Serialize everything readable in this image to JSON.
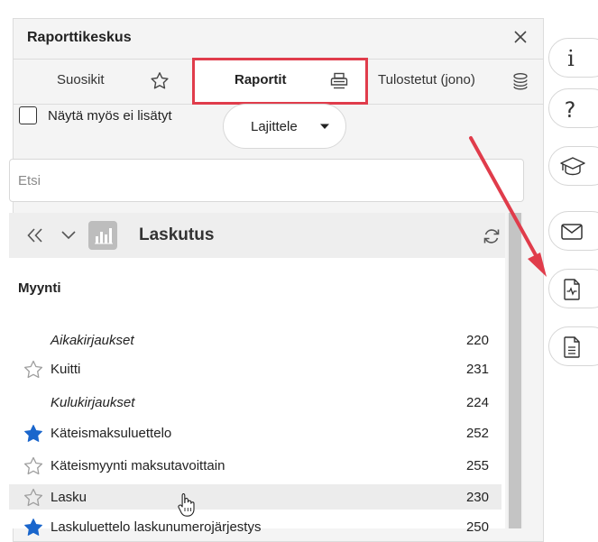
{
  "panel": {
    "title": "Raporttikeskus",
    "close_icon": "close-icon"
  },
  "tabs": [
    {
      "label": "Suosikit",
      "icon": "star-outline-icon"
    },
    {
      "label": "Raportit",
      "icon": "printer-icon",
      "active": true
    },
    {
      "label": "Tulostetut (jono)",
      "icon": "stack-icon"
    }
  ],
  "filters": {
    "show_not_added_label": "Näytä myös ei lisätyt",
    "sort_label": "Lajittele"
  },
  "search": {
    "placeholder": "Etsi",
    "value": ""
  },
  "group": {
    "title": "Laskutus"
  },
  "section": {
    "title": "Myynti"
  },
  "reports": [
    {
      "label": "Aikakirjaukset",
      "number": "220",
      "italic": true,
      "star": "none"
    },
    {
      "label": "Kuitti",
      "number": "231",
      "italic": false,
      "star": "outline"
    },
    {
      "label": "Kulukirjaukset",
      "number": "224",
      "italic": true,
      "star": "none"
    },
    {
      "label": "Käteismaksuluettelo",
      "number": "252",
      "italic": false,
      "star": "filled"
    },
    {
      "label": "Käteismyynti maksutavoittain",
      "number": "255",
      "italic": false,
      "star": "outline"
    },
    {
      "label": "Lasku",
      "number": "230",
      "italic": false,
      "star": "outline",
      "hovered": true
    },
    {
      "label": "Laskuluettelo laskunumerojärjestys",
      "number": "250",
      "italic": false,
      "star": "filled"
    }
  ],
  "right_rail": [
    {
      "icon": "info-icon"
    },
    {
      "icon": "help-icon"
    },
    {
      "icon": "graduation-cap-icon"
    },
    {
      "icon": "mail-icon"
    },
    {
      "icon": "report-chart-icon"
    },
    {
      "icon": "document-icon"
    }
  ],
  "colors": {
    "highlight_border": "#e03c4b",
    "arrow": "#e03c4b",
    "star_filled": "#1a66cc"
  }
}
